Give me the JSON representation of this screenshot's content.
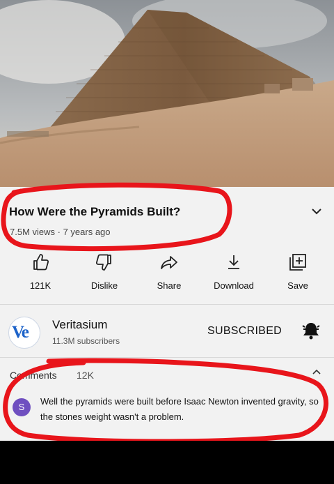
{
  "video": {
    "title": "How Were the Pyramids Built?",
    "meta": "7.5M views · 7 years ago"
  },
  "actions": [
    {
      "name": "like",
      "label": "121K",
      "icon": "thumbs-up-icon"
    },
    {
      "name": "dislike",
      "label": "Dislike",
      "icon": "thumbs-down-icon"
    },
    {
      "name": "share",
      "label": "Share",
      "icon": "share-icon"
    },
    {
      "name": "download",
      "label": "Download",
      "icon": "download-icon"
    },
    {
      "name": "save",
      "label": "Save",
      "icon": "add-to-playlist-icon"
    }
  ],
  "channel": {
    "avatar_text": "Ve",
    "name": "Veritasium",
    "subscribers": "11.3M subscribers",
    "subscribe_label": "SUBSCRIBED"
  },
  "comments": {
    "header": "Comments",
    "count": "12K",
    "top_comment": {
      "avatar_letter": "S",
      "text": "Well the pyramids were built before Isaac Newton invented gravity, so the stones weight wasn't a problem."
    }
  },
  "colors": {
    "highlight_red": "#e8151b",
    "brand_blue": "#1d63c9"
  }
}
